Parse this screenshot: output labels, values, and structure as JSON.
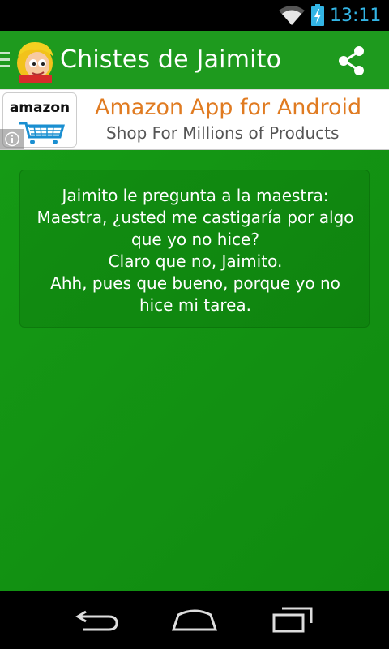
{
  "status_bar": {
    "time": "13:11",
    "icons": [
      "wifi-icon",
      "battery-charging-icon"
    ],
    "accent_color": "#33b5e5"
  },
  "action_bar": {
    "title": "Chistes de Jaimito",
    "background_color": "#1e9a1e",
    "icons": [
      "drawer-indicator-icon",
      "app-logo-icon",
      "share-icon"
    ]
  },
  "ad": {
    "logo_text": "amazon",
    "title": "Amazon App for Android",
    "subtitle": "Shop For Millions of Products",
    "title_color": "#e07b21",
    "icons": [
      "shopping-cart-icon",
      "info-icon"
    ]
  },
  "joke": {
    "text": "Jaimito le pregunta a la maestra:\nMaestra, ¿usted me castigaría por algo\nque yo no hice?\nClaro que no, Jaimito.\nAhh, pues que bueno, porque yo no\nhice mi tarea."
  },
  "nav_bar": {
    "icons": [
      "back-icon",
      "home-icon",
      "recents-icon"
    ]
  }
}
